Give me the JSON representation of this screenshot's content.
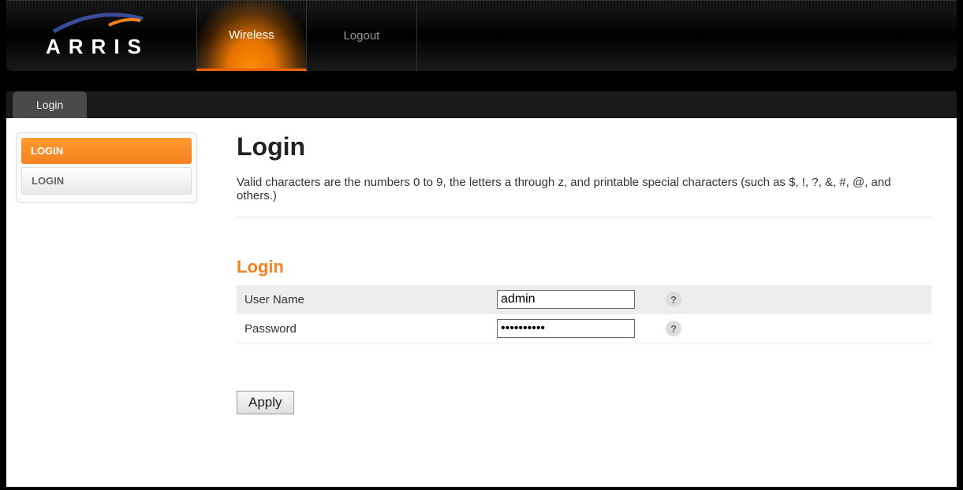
{
  "brand": "ARRIS",
  "nav": {
    "items": [
      {
        "label": "Wireless",
        "active": true
      },
      {
        "label": "Logout",
        "active": false
      }
    ]
  },
  "sub_nav": {
    "items": [
      {
        "label": "Login"
      }
    ]
  },
  "sidebar": {
    "items": [
      {
        "label": "LOGIN",
        "active": true
      },
      {
        "label": "LOGIN",
        "active": false
      }
    ]
  },
  "page": {
    "title": "Login",
    "description": "Valid characters are the numbers 0 to 9, the letters a through z, and printable special characters (such as $, !, ?, &, #, @, and others.)",
    "section_title": "Login"
  },
  "form": {
    "username_label": "User Name",
    "username_value": "admin",
    "password_label": "Password",
    "password_value": "••••••••••",
    "apply_label": "Apply"
  }
}
